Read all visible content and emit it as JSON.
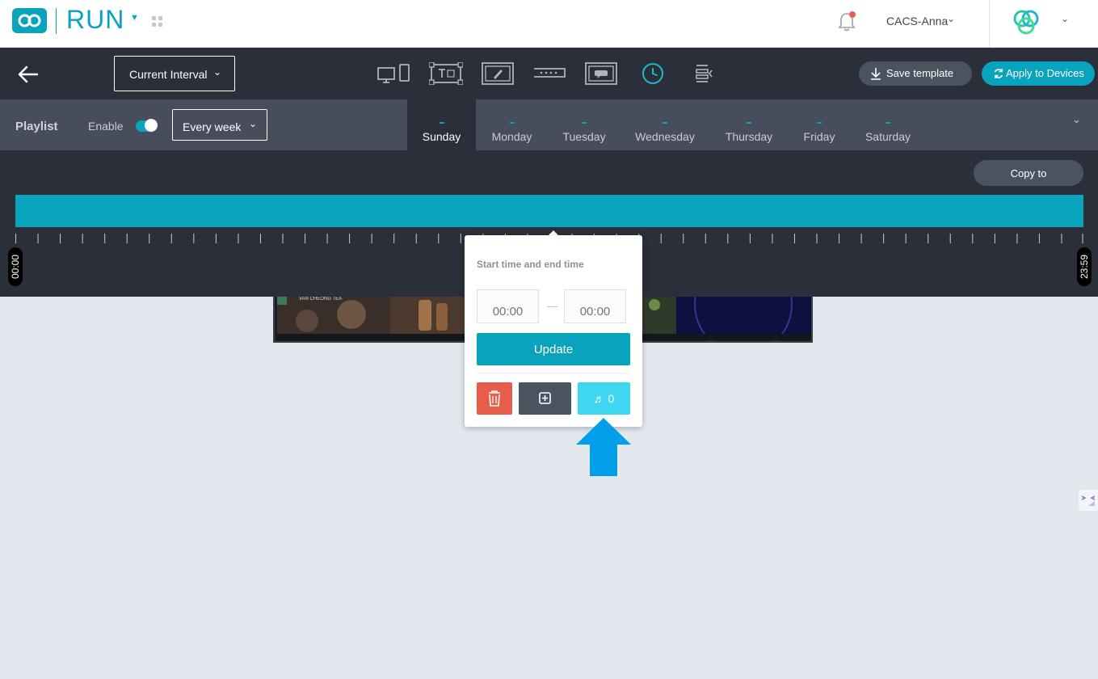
{
  "header": {
    "app_name": "RUN",
    "user_name": "CACS-Anna"
  },
  "toolbar": {
    "interval_select": "Current Interval",
    "save_template": "Save template",
    "apply_to_devices": "Apply to Devices",
    "tool_icons": [
      "screens-icon",
      "text-widget-icon",
      "edit-frame-icon",
      "ticker-icon",
      "message-icon",
      "clock-icon",
      "align-icon"
    ],
    "active_tool": "clock-icon"
  },
  "playlist": {
    "title": "Playlist",
    "enable_label": "Enable",
    "enabled": true,
    "repeat_select": "Every week",
    "days": [
      "Sunday",
      "Monday",
      "Tuesday",
      "Wednesday",
      "Thursday",
      "Friday",
      "Saturday"
    ],
    "active_day": "Sunday"
  },
  "timeline": {
    "copy_to": "Copy to",
    "start_label": "00:00",
    "end_label": "23:59"
  },
  "popup": {
    "title": "Start time and end time",
    "start_time_placeholder": "00:00",
    "end_time_placeholder": "00:00",
    "dash": "—",
    "update": "Update",
    "music_count": "0"
  },
  "preview": {
    "video_title": "VAN CHEONG TEA"
  },
  "colors": {
    "accent": "#0aa3bd",
    "dark": "#2b2f39",
    "danger": "#e85c4a",
    "music": "#3fd6f2",
    "arrow": "#009fe8"
  }
}
